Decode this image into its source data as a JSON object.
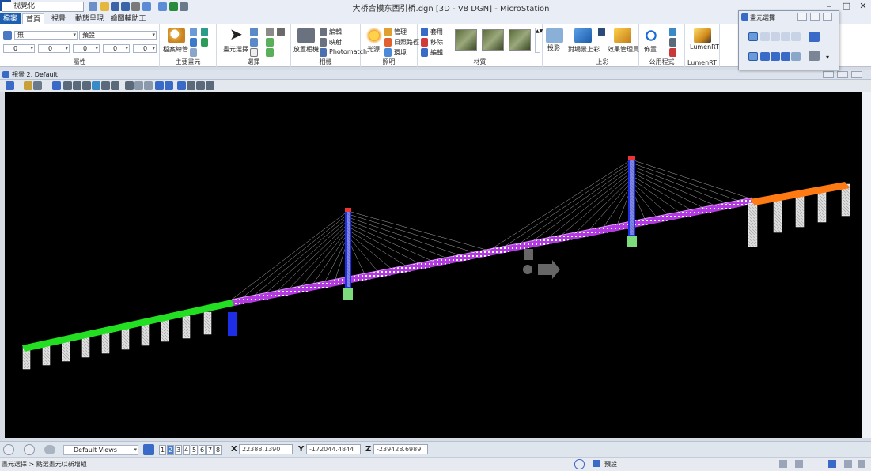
{
  "window": {
    "title": "大桥合模东西引桥.dgn [3D - V8 DGN] - MicroStation",
    "workflow": "视覺化",
    "logo": "M"
  },
  "ribbon": {
    "tabs": [
      "檔案",
      "首頁",
      "視景",
      "動態呈現",
      "繪圖輔助工具"
    ],
    "groups": {
      "attributes": {
        "label": "屬性",
        "level_value": "無",
        "style_value": "預設",
        "color_value": "0",
        "weight_value": "0",
        "line_value": "0",
        "fill_value": "0"
      },
      "primary": {
        "label": "主要畫元",
        "explorer": "檔案總管"
      },
      "selection": {
        "label": "選擇",
        "element_select": "畫元選擇"
      },
      "camera": {
        "label": "相機",
        "place_camera": "放置相機",
        "edit": "編輯",
        "map": "映射",
        "photomatch": "Photomatch"
      },
      "lighting": {
        "label": "照明",
        "light_source": "光源",
        "manage": "管理",
        "sun_path": "日照路徑",
        "environment": "環境"
      },
      "materials": {
        "label": "材質",
        "apply": "套用",
        "remove": "移除",
        "edit": "編輯"
      },
      "projection": {
        "label": "投影"
      },
      "render": {
        "label": "上彩",
        "object_render": "對場景上彩",
        "effects": "效果管理員"
      },
      "utilities": {
        "label": "公用程式",
        "layout": "佈置"
      },
      "lumenrt": {
        "label": "LumenRT",
        "button": "LumenRT"
      }
    }
  },
  "view": {
    "title": "視景 2, Default"
  },
  "bottom": {
    "view_group": "Default Views",
    "views": [
      "1",
      "2",
      "3",
      "4",
      "5",
      "6",
      "7",
      "8"
    ],
    "active_view": "2",
    "x_label": "X",
    "x_value": "22388.1390",
    "y_label": "Y",
    "y_value": "-172044.4844",
    "z_label": "Z",
    "z_value": "-239428.6989"
  },
  "status": {
    "prompt": "畫元選擇 > 點選畫元以新增組",
    "level": "預設"
  },
  "float_window": {
    "title": "畫元選擇"
  },
  "colors": {
    "accent": "#1f5fb0",
    "bridge_west": "#22e021",
    "bridge_east": "#ff7a12",
    "deck": "#c53ce0",
    "tower": "#1326e8",
    "cables": "#ffffff"
  }
}
